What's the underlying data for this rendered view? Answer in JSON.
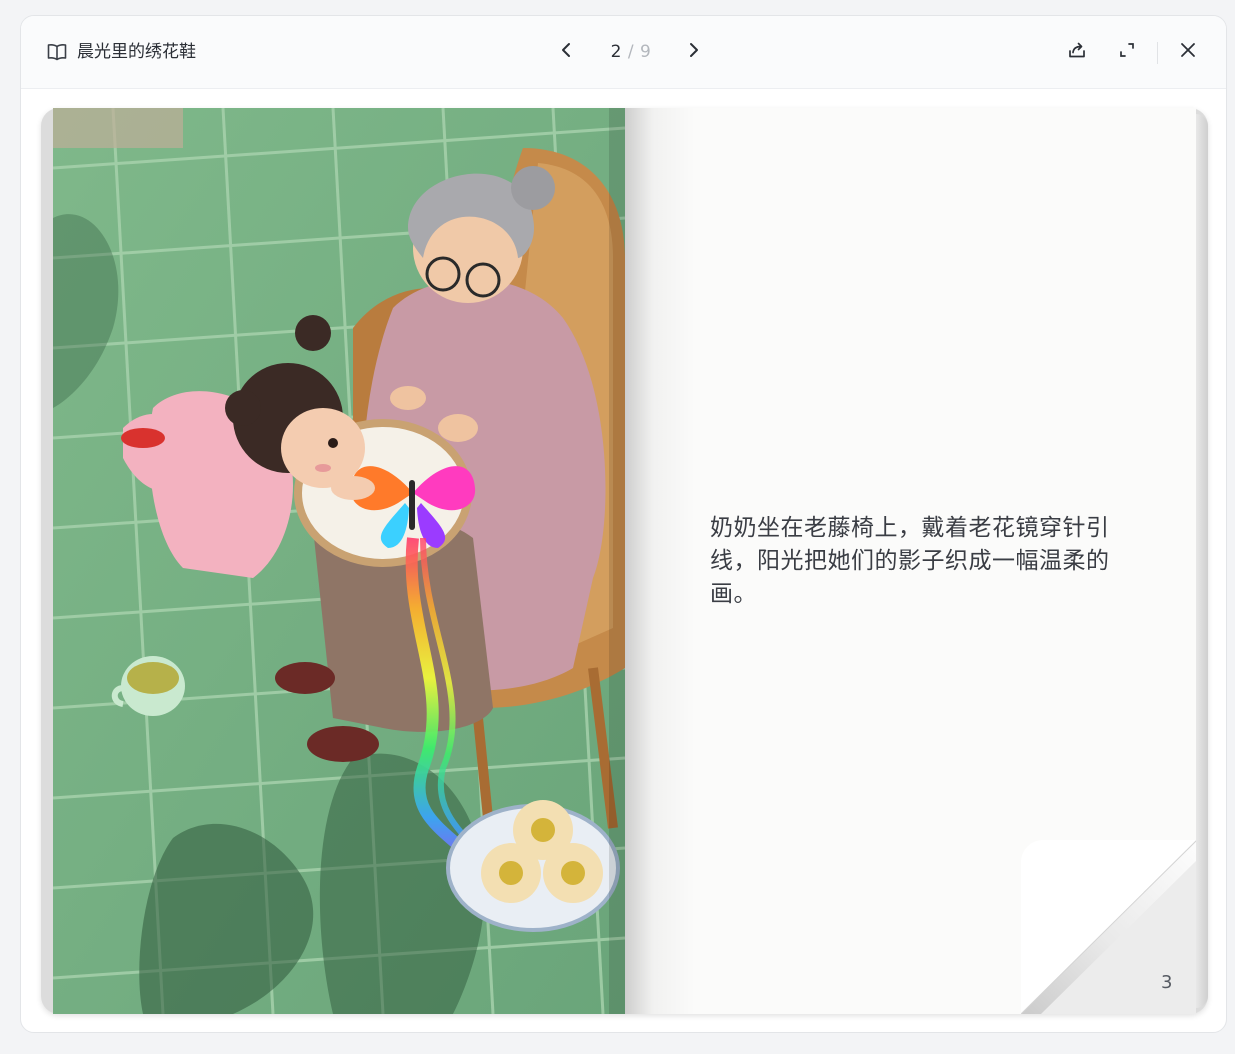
{
  "header": {
    "title": "晨光里的绣花鞋",
    "book_icon": "book-open-icon",
    "pager": {
      "current": "2",
      "separator": "/",
      "total": "9",
      "prev_icon": "chevron-left-icon",
      "next_icon": "chevron-right-icon"
    },
    "actions": {
      "share_icon": "share-icon",
      "fullscreen_icon": "fullscreen-icon",
      "close_icon": "close-icon"
    }
  },
  "book": {
    "illustration_icon": "illustration-image",
    "right_page": {
      "text": "奶奶坐在老藤椅上，戴着老花镜穿针引线，阳光把她们的影子织成一幅温柔的画。",
      "page_number": "3"
    }
  },
  "colors": {
    "accent_text": "#2b2f36",
    "muted": "#b3b7bd",
    "paper": "#fbfbfa"
  }
}
